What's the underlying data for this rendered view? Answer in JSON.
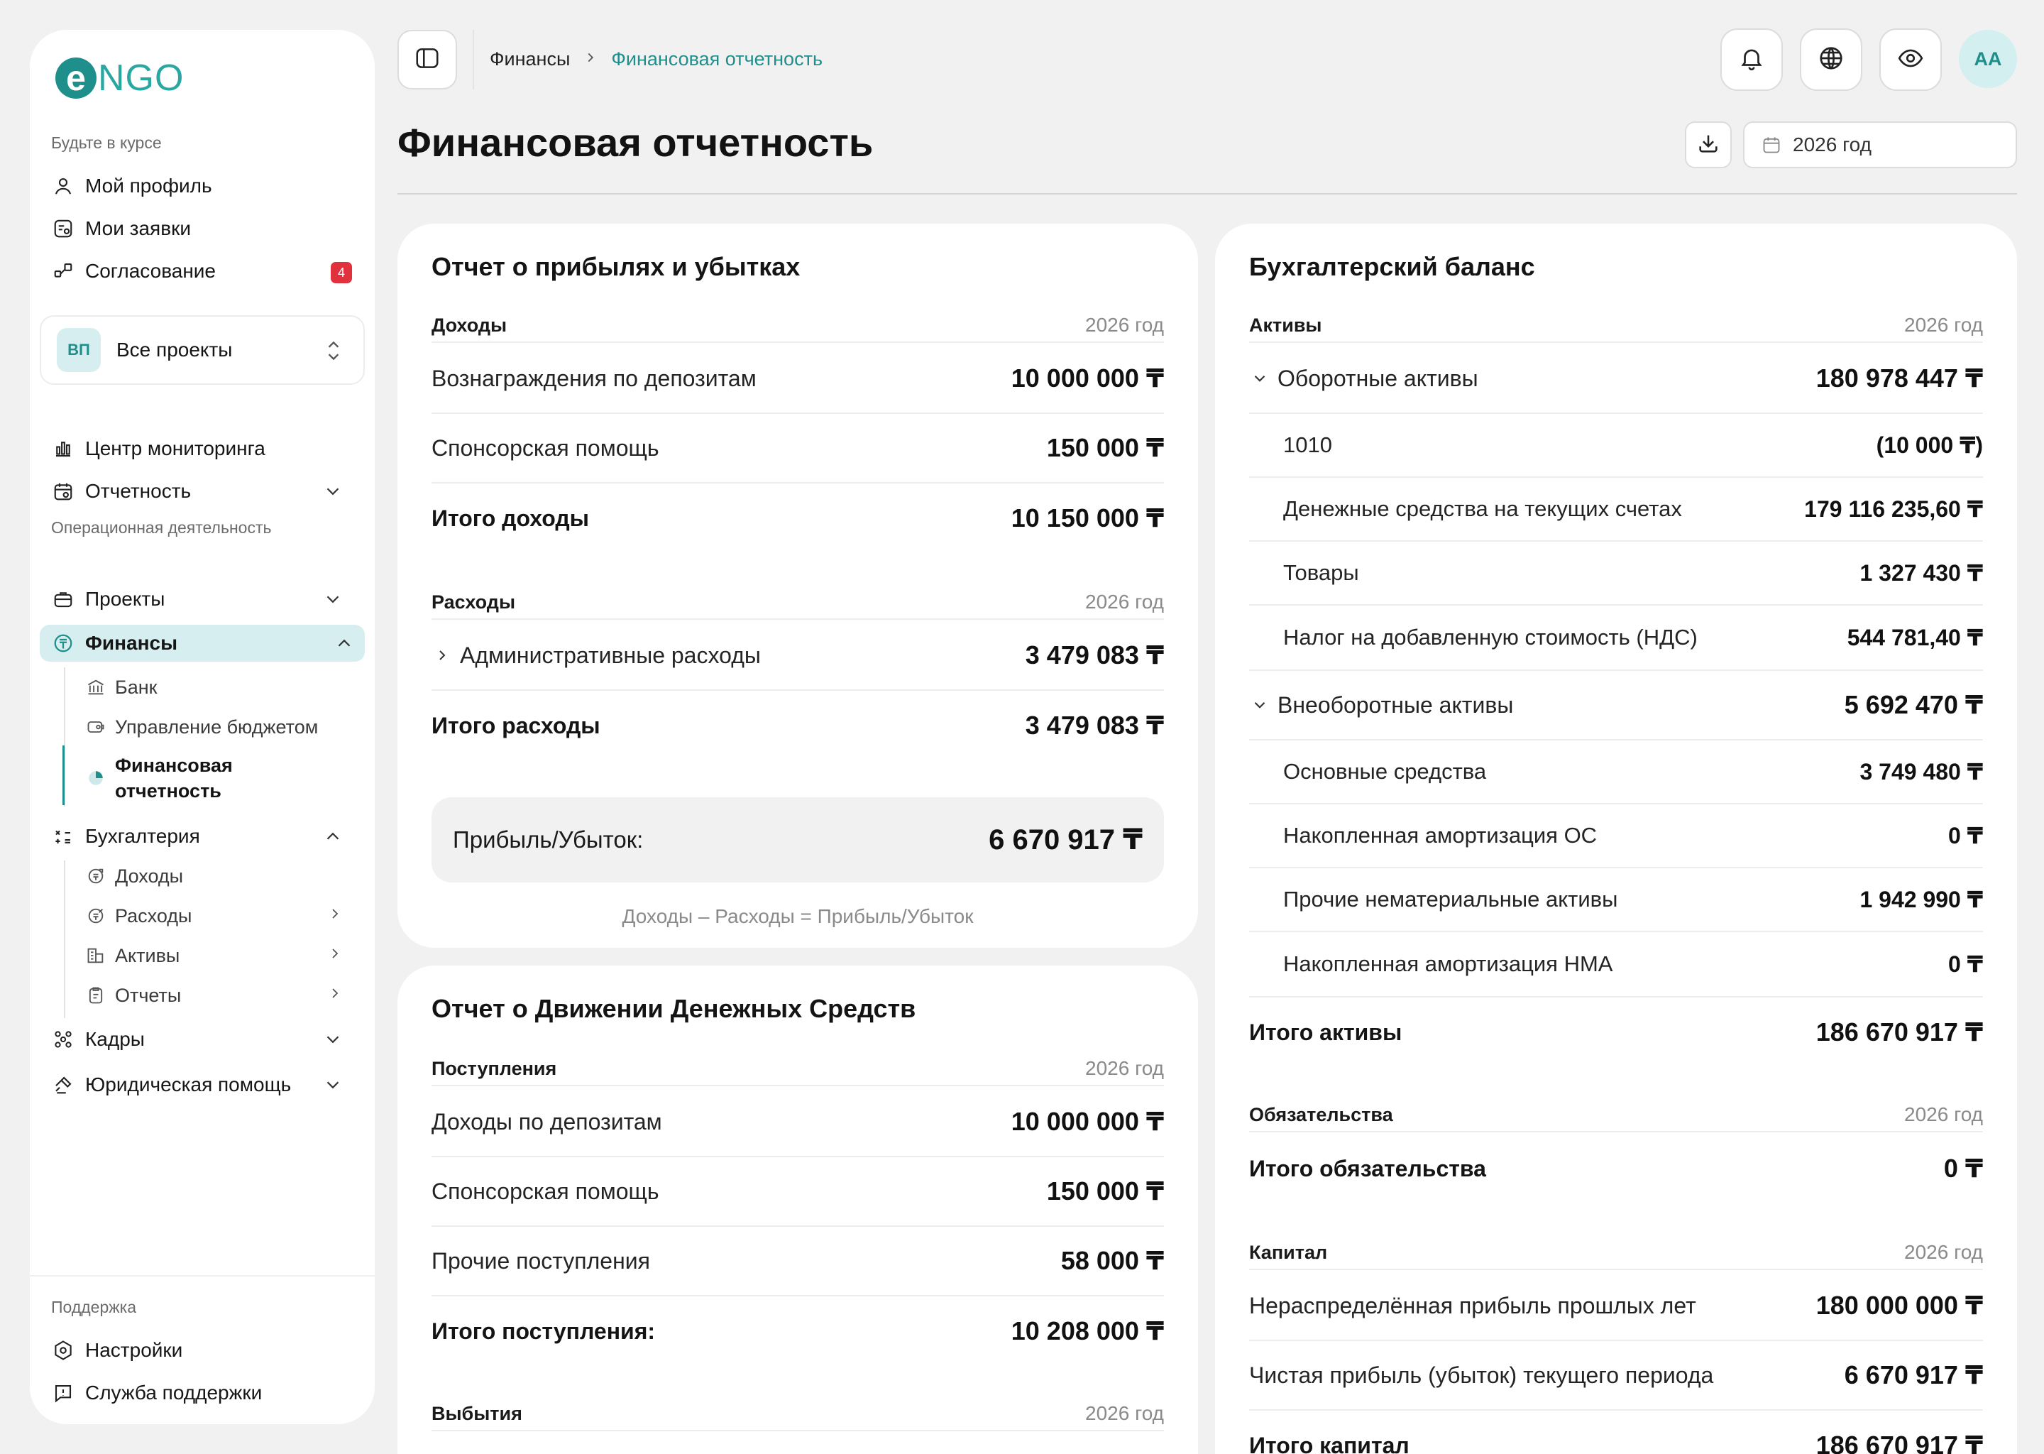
{
  "brand": {
    "logo_mark": "e",
    "logo_text": "NGO"
  },
  "sidebar": {
    "section_news": "Будьте в курсе",
    "profile": "Мой профиль",
    "my_requests": "Мои заявки",
    "approval": "Согласование",
    "approval_badge": "4",
    "project": {
      "initials": "ВП",
      "label": "Все проекты"
    },
    "monitoring": "Центр мониторинга",
    "reporting": "Отчетность",
    "section_ops": "Операционная деятельность",
    "projects": "Проекты",
    "finance": "Финансы",
    "finance_sub": {
      "bank": "Банк",
      "budget": "Управление бюджетом",
      "fin_report_line1": "Финансовая",
      "fin_report_line2": "отчетность"
    },
    "accounting": "Бухгалтерия",
    "accounting_sub": {
      "income": "Доходы",
      "expenses": "Расходы",
      "assets": "Активы",
      "reports": "Отчеты"
    },
    "hr": "Кадры",
    "legal": "Юридическая помощь",
    "section_support": "Поддержка",
    "settings": "Настройки",
    "help": "Служба поддержки"
  },
  "topbar": {
    "breadcrumb_1": "Финансы",
    "breadcrumb_2": "Финансовая отчетность",
    "avatar": "АА"
  },
  "page": {
    "title": "Финансовая отчетность",
    "year": "2026 год"
  },
  "pl": {
    "title": "Отчет о прибылях и убытках",
    "income_head": "Доходы",
    "year": "2026 год",
    "income_rows": [
      {
        "label": "Вознаграждения по депозитам",
        "value": "10 000 000 ₸"
      },
      {
        "label": "Спонсорская помощь",
        "value": "150 000 ₸"
      }
    ],
    "income_total": {
      "label": "Итого доходы",
      "value": "10 150 000 ₸"
    },
    "expense_head": "Расходы",
    "expense_rows": [
      {
        "label": "Административные расходы",
        "value": "3 479 083 ₸"
      }
    ],
    "expense_total": {
      "label": "Итого расходы",
      "value": "3 479 083 ₸"
    },
    "profit": {
      "label": "Прибыль/Убыток:",
      "value": "6 670 917 ₸"
    },
    "formula": "Доходы – Расходы = Прибыль/Убыток"
  },
  "cf": {
    "title": "Отчет о Движении Денежных Средств",
    "in_head": "Поступления",
    "year": "2026 год",
    "in_rows": [
      {
        "label": "Доходы по депозитам",
        "value": "10 000 000 ₸"
      },
      {
        "label": "Спонсорская помощь",
        "value": "150 000 ₸"
      },
      {
        "label": "Прочие поступления",
        "value": "58 000 ₸"
      }
    ],
    "in_total": {
      "label": "Итого поступления:",
      "value": "10 208 000 ₸"
    },
    "out_head": "Выбытия"
  },
  "bs": {
    "title": "Бухгалтерский баланс",
    "assets_head": "Активы",
    "year": "2026 год",
    "current": {
      "label": "Оборотные активы",
      "value": "180 978 447 ₸"
    },
    "current_rows": [
      {
        "label": "1010",
        "value": "(10 000 ₸)"
      },
      {
        "label": "Денежные средства на текущих счетах",
        "value": "179 116 235,60 ₸"
      },
      {
        "label": "Товары",
        "value": "1 327 430 ₸"
      },
      {
        "label": "Налог на добавленную стоимость (НДС)",
        "value": "544 781,40 ₸"
      }
    ],
    "noncurrent": {
      "label": "Внеоборотные активы",
      "value": "5 692 470 ₸"
    },
    "noncurrent_rows": [
      {
        "label": "Основные средства",
        "value": "3 749 480 ₸"
      },
      {
        "label": "Накопленная амортизация ОС",
        "value": "0 ₸"
      },
      {
        "label": "Прочие нематериальные активы",
        "value": "1 942 990 ₸"
      },
      {
        "label": "Накопленная амортизация НМА",
        "value": "0 ₸"
      }
    ],
    "assets_total": {
      "label": "Итого активы",
      "value": "186 670 917 ₸"
    },
    "liab_head": "Обязательства",
    "liab_total": {
      "label": "Итого обязательства",
      "value": "0 ₸"
    },
    "equity_head": "Капитал",
    "equity_rows": [
      {
        "label": "Нераспределённая прибыль прошлых лет",
        "value": "180 000 000 ₸"
      },
      {
        "label": "Чистая прибыль (убыток) текущего периода",
        "value": "6 670 917 ₸"
      }
    ],
    "equity_total": {
      "label": "Итого капитал",
      "value": "186 670 917 ₸"
    }
  }
}
